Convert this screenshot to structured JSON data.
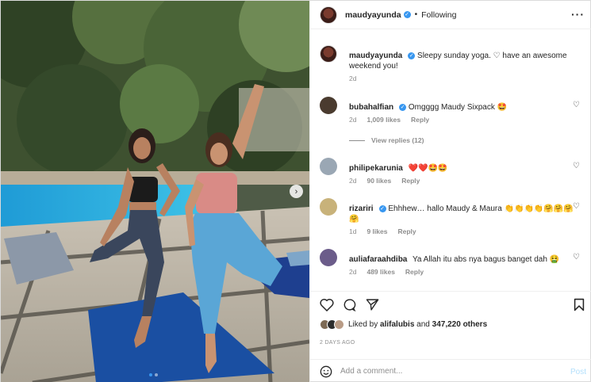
{
  "header": {
    "username": "maudyayunda",
    "separator": "•",
    "follow_status": "Following",
    "more_icon": "more-horizontal-icon"
  },
  "caption": {
    "username": "maudyayunda",
    "text": "Sleepy sunday yoga. ♡ have an awesome weekend you!",
    "time": "2d"
  },
  "comments": [
    {
      "username": "bubahalfian",
      "verified": true,
      "text": "Omgggg Maudy Sixpack 🤩",
      "time": "2d",
      "likes": "1,009 likes",
      "reply": "Reply",
      "avatar_color": "#4a3b2f"
    },
    {
      "username": "philipekarunia",
      "verified": false,
      "text": "❤️❤️🤩🤩",
      "time": "2d",
      "likes": "90 likes",
      "reply": "Reply",
      "avatar_color": "#9aa7b4"
    },
    {
      "username": "rizariri",
      "verified": true,
      "text": "Ehhhew… hallo Maudy & Maura 👏👏👏👏🤗🤗🤗🤗",
      "time": "1d",
      "likes": "9 likes",
      "reply": "Reply",
      "avatar_color": "#c8b27a"
    },
    {
      "username": "auliafaraahdiba",
      "verified": false,
      "text": "Ya Allah itu abs nya bagus banget dah 🤮",
      "time": "2d",
      "likes": "489 likes",
      "reply": "Reply",
      "avatar_color": "#6b5c8a"
    }
  ],
  "view_replies": "View replies (12)",
  "liked_by": {
    "prefix": "Liked by",
    "user": "alifalubis",
    "conj": "and",
    "others": "347,220 others"
  },
  "timestamp": "2 DAYS AGO",
  "add_comment": {
    "placeholder": "Add a comment...",
    "post_label": "Post"
  },
  "colors": {
    "verified": "#3897f0",
    "post_disabled": "#b2dffc",
    "secondary_text": "#8e8e8e"
  },
  "carousel": {
    "slides": 2,
    "current": 1
  }
}
